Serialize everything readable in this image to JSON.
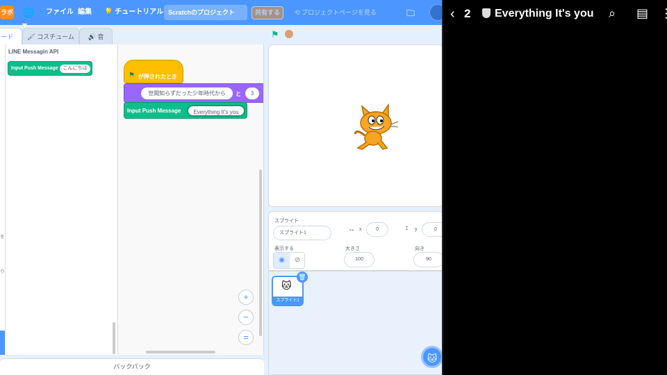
{
  "menubar": {
    "logo": "ラボ",
    "file": "ファイル",
    "edit": "編集",
    "tutorial": "チュートリアル",
    "project_title": "Scratchのプロジェクト",
    "share": "共有する",
    "project_page": "プロジェクトページを見る"
  },
  "tabs": {
    "code": "コード",
    "costume": "コスチューム",
    "sound": "音"
  },
  "palette": {
    "title": "LINE Messagin API",
    "block_label": "Input Push Message",
    "block_arg": "こんにちは",
    "cat_marker_1": "を",
    "cat_marker_2": "り"
  },
  "script": {
    "hat_label": "が押されたとき",
    "say_text": "世間知らずだった少年時代から",
    "say_mid": "と",
    "say_secs": "3",
    "push_label": "Input Push Message",
    "push_arg": "Everything It's you"
  },
  "zoom": {
    "in": "+",
    "out": "−",
    "reset": "="
  },
  "backpack": "バックパック",
  "sprite": {
    "label": "スプライト",
    "name": "スプライト1",
    "x_label": "x",
    "x": "0",
    "y_label": "y",
    "y": "0",
    "show_label": "表示する",
    "size_label": "大きさ",
    "size": "100",
    "direction_label": "向き",
    "direction": "90",
    "thumb_name": "スプライト1"
  },
  "dark_panel": {
    "count": "2",
    "title": "Everything It's you"
  },
  "colors": {
    "scratch_blue": "#4c97ff",
    "events_yellow": "#ffbf00",
    "looks_purple": "#9966ff",
    "extension_green": "#0fbd8c"
  }
}
